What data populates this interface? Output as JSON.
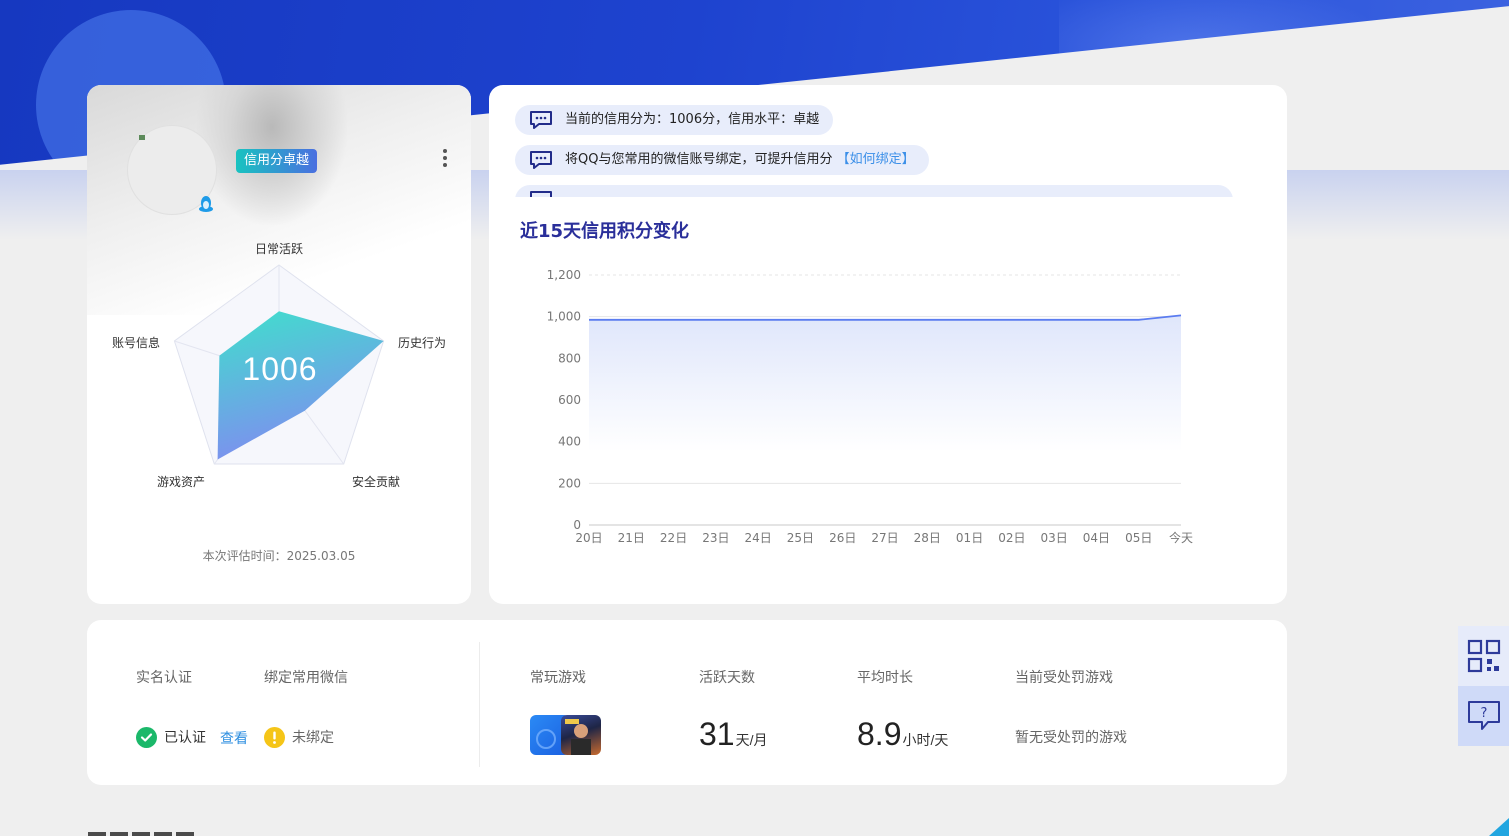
{
  "profile": {
    "badge": "信用分卓越",
    "score": "1006",
    "eval_time": "本次评估时间：2025.03.05",
    "radar": {
      "labels": [
        "日常活跃",
        "历史行为",
        "安全贡献",
        "游戏资产",
        "账号信息"
      ],
      "values": [
        0.58,
        1.0,
        0.4,
        0.95,
        0.57
      ]
    }
  },
  "notices": [
    {
      "text": "当前的信用分为：1006分，信用水平：卓越",
      "link": ""
    },
    {
      "text": "将QQ与您常用的微信账号绑定，可提升信用分",
      "link": "【如何绑定】"
    },
    {
      "text": "",
      "link": ""
    }
  ],
  "chart_section": {
    "title": "近15天信用积分变化"
  },
  "chart_data": {
    "type": "area",
    "title": "近15天信用积分变化",
    "xlabel": "",
    "ylabel": "",
    "x": [
      "20日",
      "21日",
      "22日",
      "23日",
      "24日",
      "25日",
      "26日",
      "27日",
      "28日",
      "01日",
      "02日",
      "03日",
      "04日",
      "05日",
      "今天"
    ],
    "values": [
      985,
      985,
      985,
      985,
      985,
      985,
      985,
      985,
      985,
      985,
      985,
      985,
      985,
      985,
      1006
    ],
    "ylim": [
      0,
      1200
    ],
    "yticks": [
      "0",
      "200",
      "400",
      "600",
      "800",
      "1,000",
      "1,200"
    ],
    "grid": true,
    "colors": {
      "line": "#5b7cf0",
      "fill": "#dfe6fb"
    }
  },
  "info": {
    "realname_label": "实名认证",
    "realname_status": "已认证",
    "realname_view": "查看",
    "wechat_label": "绑定常用微信",
    "wechat_status": "未绑定",
    "games_label": "常玩游戏",
    "active_label": "活跃天数",
    "active_value": "31",
    "active_unit": "天/月",
    "avg_label": "平均时长",
    "avg_value": "8.9",
    "avg_unit": "小时/天",
    "penalty_label": "当前受处罚游戏",
    "penalty_value": "暂无受处罚的游戏"
  },
  "icons": {
    "more": "more-vertical-icon",
    "qq": "qq-penguin-icon",
    "chat": "chat-bubble-icon",
    "qr": "qrcode-icon",
    "help": "help-bubble-icon"
  }
}
